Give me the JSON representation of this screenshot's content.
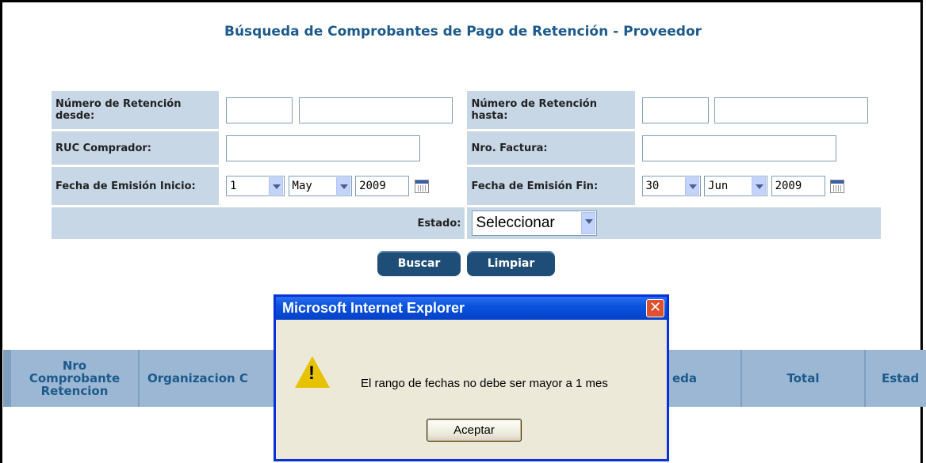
{
  "page": {
    "title": "Búsqueda de Comprobantes de Pago de Retención - Proveedor"
  },
  "form": {
    "retencion_desde_label": "Número de Retención desde:",
    "retencion_hasta_label": "Número de Retención hasta:",
    "ruc_label": "RUC Comprador:",
    "factura_label": "Nro. Factura:",
    "fecha_inicio_label": "Fecha de Emisión Inicio:",
    "fecha_fin_label": "Fecha de Emisión Fin:",
    "fecha_inicio": {
      "day": "1",
      "month": "May",
      "year": "2009"
    },
    "fecha_fin": {
      "day": "30",
      "month": "Jun",
      "year": "2009"
    },
    "estado_label": "Estado:",
    "estado_value": "Seleccionar"
  },
  "buttons": {
    "buscar": "Buscar",
    "limpiar": "Limpiar"
  },
  "table": {
    "headers": [
      "Nro Comprobante Retencion",
      "Organizacion C",
      "eda",
      "Total",
      "Estad"
    ]
  },
  "dialog": {
    "title": "Microsoft Internet Explorer",
    "close": "✕",
    "message": "El rango de fechas no debe ser mayor a 1 mes",
    "ok": "Aceptar",
    "icon": "warning-icon",
    "icon_glyph": "!"
  }
}
